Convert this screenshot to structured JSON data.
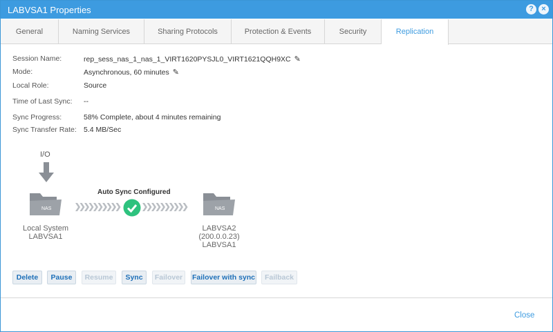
{
  "window": {
    "title": "LABVSA1 Properties",
    "help_glyph": "?",
    "close_glyph": "×"
  },
  "tabs": [
    {
      "label": "General"
    },
    {
      "label": "Naming Services"
    },
    {
      "label": "Sharing Protocols"
    },
    {
      "label": "Protection & Events"
    },
    {
      "label": "Security"
    },
    {
      "label": "Replication",
      "active": true
    }
  ],
  "details": {
    "session_name_label": "Session Name:",
    "session_name_value": "rep_sess_nas_1_nas_1_VIRT1620PYSJL0_VIRT1621QQH9XC",
    "mode_label": "Mode:",
    "mode_value": "Asynchronous, 60 minutes",
    "local_role_label": "Local Role:",
    "local_role_value": "Source",
    "last_sync_label": "Time of Last Sync:",
    "last_sync_value": "--",
    "sync_progress_label": "Sync Progress:",
    "sync_progress_value": "58% Complete, about 4 minutes remaining",
    "transfer_rate_label": "Sync Transfer Rate:",
    "transfer_rate_value": "5.4 MB/Sec"
  },
  "diagram": {
    "io_label": "I/O",
    "sync_status": "Auto Sync Configured",
    "folder_badge": "NAS",
    "local": {
      "line1": "Local System",
      "line2": "LABVSA1"
    },
    "remote": {
      "line1": "LABVSA2",
      "line2": "(200.0.0.23)",
      "line3": "LABVSA1"
    },
    "status_color": "#2ec27e",
    "folder_color": "#8a8f96"
  },
  "actions": {
    "delete": "Delete",
    "pause": "Pause",
    "resume": "Resume",
    "sync": "Sync",
    "failover": "Failover",
    "failover_with_sync": "Failover with sync",
    "failback": "Failback"
  },
  "footer": {
    "close": "Close"
  },
  "icons": {
    "pencil": "edit-pencil-icon",
    "io_arrow": "arrow-down-icon",
    "status": "check-circle-icon",
    "folder": "nas-folder-icon"
  }
}
